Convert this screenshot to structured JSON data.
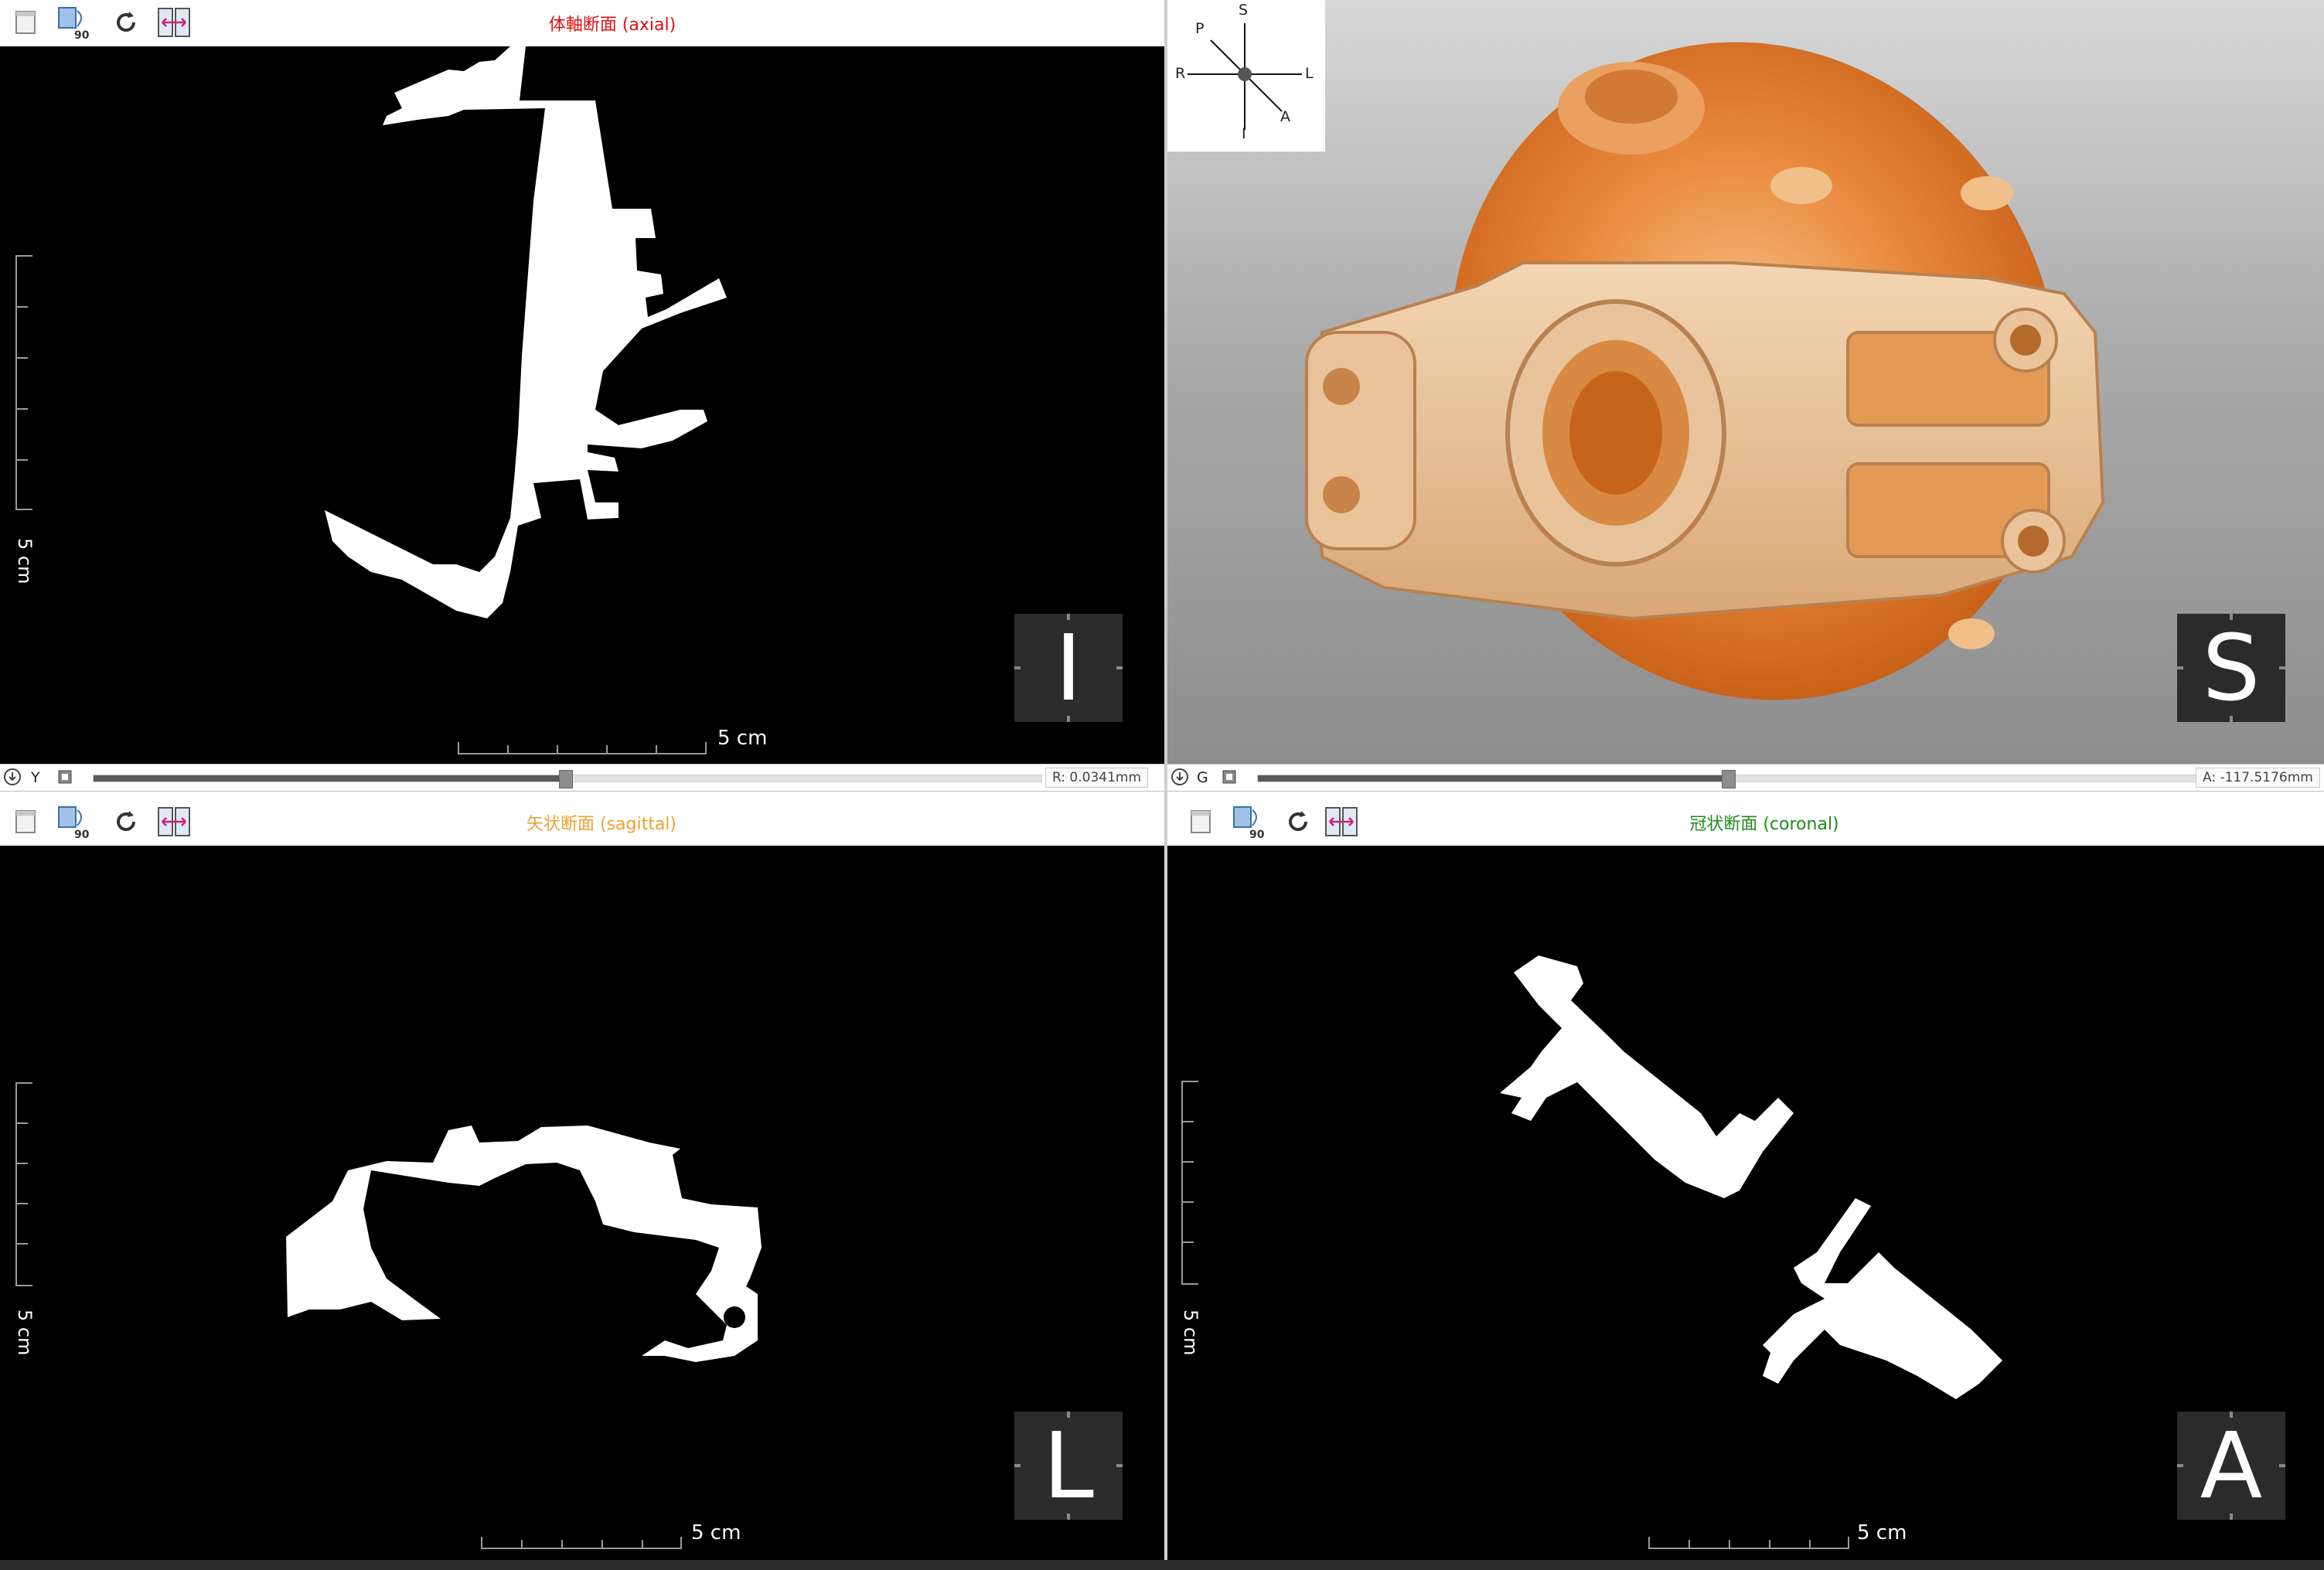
{
  "panes": {
    "axial": {
      "title": "体軸断面 (axial)",
      "title_color": "#e01010",
      "scale_label": "5 cm",
      "vscale_label": "5 cm",
      "orientation": "I"
    },
    "render3d": {
      "orientation": "S"
    },
    "sagittal": {
      "title": "矢状断面 (sagittal)",
      "title_color": "#f0a030",
      "scale_label": "5 cm",
      "vscale_label": "5 cm",
      "orientation": "L"
    },
    "coronal": {
      "title": "冠状断面 (coronal)",
      "title_color": "#1f8a1f",
      "scale_label": "5 cm",
      "vscale_label": "5 cm",
      "orientation": "A"
    }
  },
  "toolbar": {
    "rotate_label": "90°"
  },
  "sliders": {
    "left": {
      "axis": "Y",
      "readout": "R: 0.0341mm",
      "position": 0.5
    },
    "right": {
      "axis": "G",
      "readout": "A: -117.5176mm",
      "position": 0.5
    }
  },
  "orientation_widget": {
    "S": "S",
    "I": "I",
    "R": "R",
    "L": "L",
    "P": "P",
    "A": "A"
  },
  "icons": [
    "window-icon",
    "rotate-90-icon",
    "reset-icon",
    "flip-icon",
    "pin-icon",
    "crop-icon"
  ]
}
